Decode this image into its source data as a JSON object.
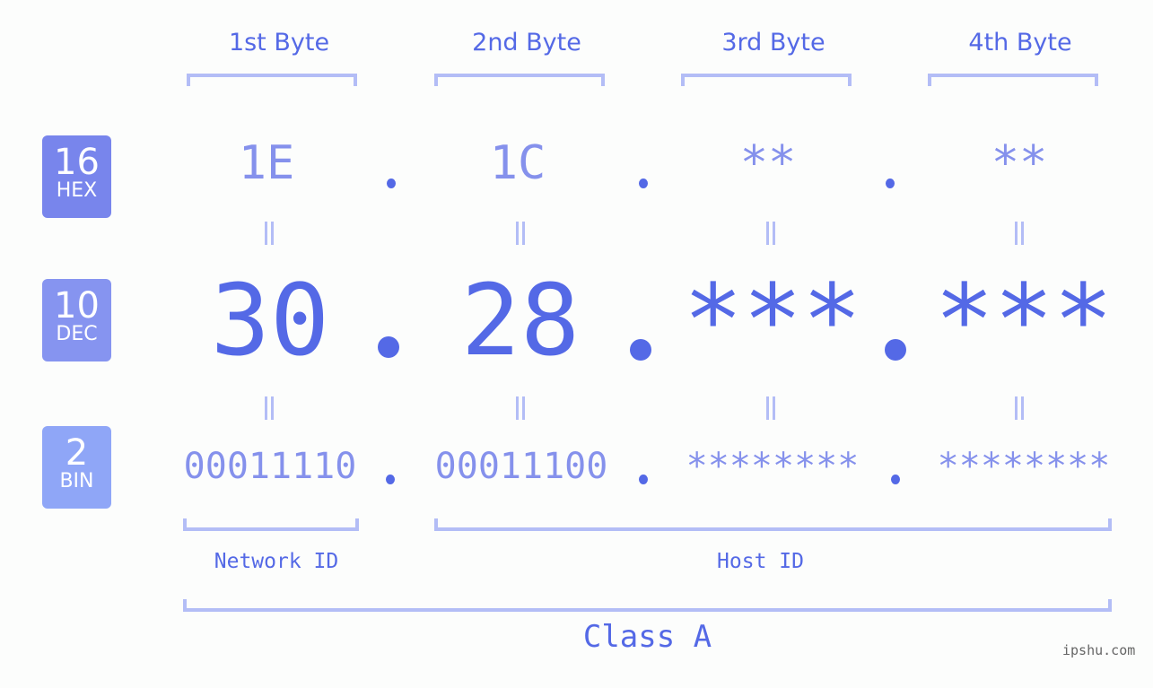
{
  "bytes": [
    {
      "header": "1st Byte",
      "hex": "1E",
      "dec": "30",
      "bin": "00011110"
    },
    {
      "header": "2nd Byte",
      "hex": "1C",
      "dec": "28",
      "bin": "00011100"
    },
    {
      "header": "3rd Byte",
      "hex": "**",
      "dec": "***",
      "bin": "********"
    },
    {
      "header": "4th Byte",
      "hex": "**",
      "dec": "***",
      "bin": "********"
    }
  ],
  "badges": {
    "hex": {
      "number": "16",
      "label": "HEX",
      "color": "#7885ec"
    },
    "dec": {
      "number": "10",
      "label": "DEC",
      "color": "#8694f0"
    },
    "bin": {
      "number": "2",
      "label": "BIN",
      "color": "#8fa6f7"
    }
  },
  "sections": {
    "network_id": "Network ID",
    "host_id": "Host ID",
    "ip_class": "Class A"
  },
  "colors": {
    "primary": "#5469e6",
    "secondary": "#8591ec",
    "bracket": "#b3bdf6"
  },
  "watermark": "ipshu.com"
}
